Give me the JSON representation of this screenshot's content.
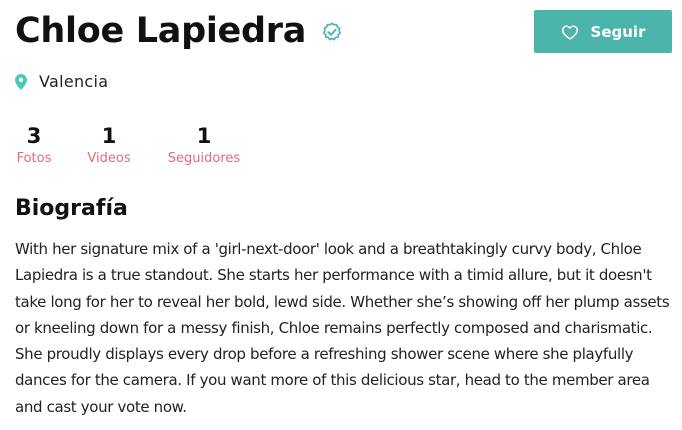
{
  "profile": {
    "name": "Chloe Lapiedra",
    "verified": true,
    "location": "Valencia"
  },
  "actions": {
    "follow_label": "Seguir"
  },
  "stats": [
    {
      "value": "3",
      "label": "Fotos"
    },
    {
      "value": "1",
      "label": "Videos"
    },
    {
      "value": "1",
      "label": "Seguidores"
    }
  ],
  "bio": {
    "title": "Biografía",
    "text": "With her signature mix of a 'girl-next-door' look and a breathtakingly curvy body, Chloe Lapiedra is a true standout. She starts her performance with a timid allure, but it doesn't take long for her to reveal her bold, lewd side. Whether she’s showing off her plump assets or kneeling down for a messy finish, Chloe remains perfectly composed and charismatic. She proudly displays every drop before a refreshing shower scene where she playfully dances for the camera. If you want more of this delicious star, head to the member area and cast your vote now."
  },
  "colors": {
    "accent": "#4cb5ab",
    "label": "#e36a7a",
    "verified": "#4cb5ab",
    "pin": "#4cc9b9"
  },
  "icons": {
    "verified": "verified-badge-icon",
    "follow": "heart-icon",
    "location": "map-pin-icon"
  }
}
